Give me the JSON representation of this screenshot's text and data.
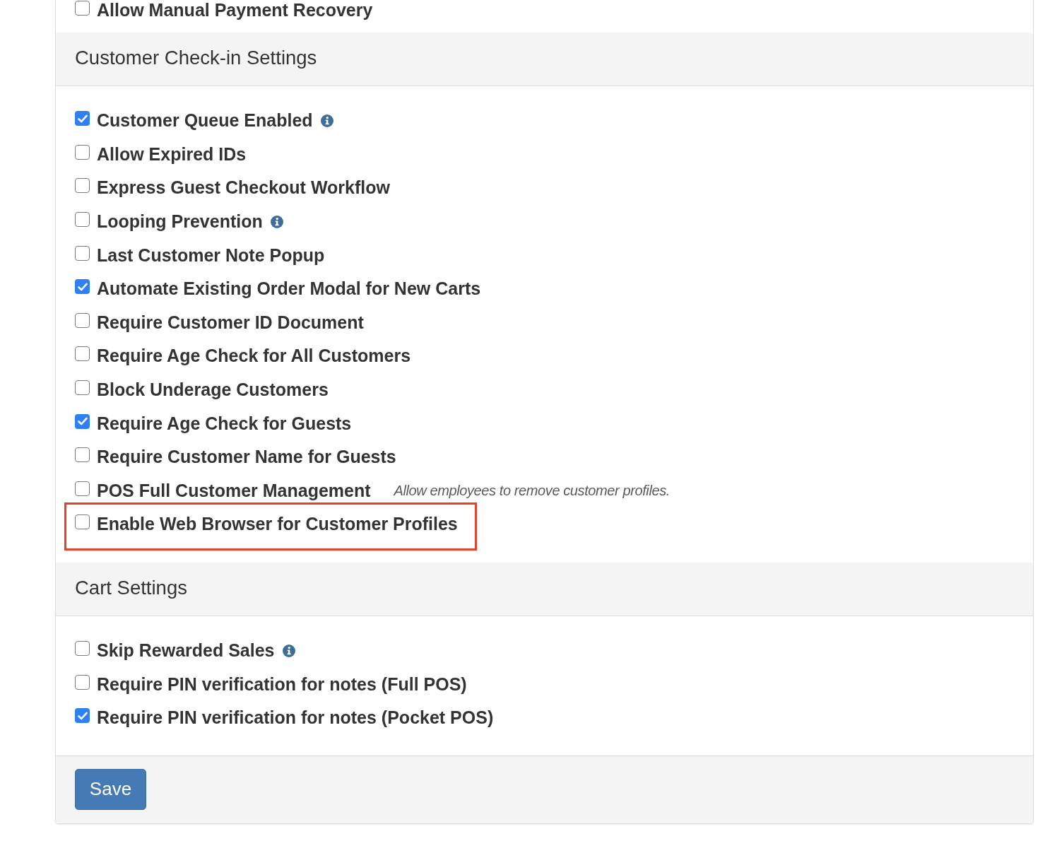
{
  "sections": [
    {
      "options": [
        {
          "label": "Allow Manual Payment Recovery",
          "checked": false,
          "info": false,
          "highlighted": false
        }
      ]
    },
    {
      "title": "Customer Check-in Settings",
      "options": [
        {
          "label": "Customer Queue Enabled",
          "checked": true,
          "info": true,
          "highlighted": false
        },
        {
          "label": "Allow Expired IDs",
          "checked": false,
          "info": false,
          "highlighted": false
        },
        {
          "label": "Express Guest Checkout Workflow",
          "checked": false,
          "info": false,
          "highlighted": false
        },
        {
          "label": "Looping Prevention",
          "checked": false,
          "info": true,
          "highlighted": false
        },
        {
          "label": "Last Customer Note Popup",
          "checked": false,
          "info": false,
          "highlighted": false
        },
        {
          "label": "Automate Existing Order Modal for New Carts",
          "checked": true,
          "info": false,
          "highlighted": false
        },
        {
          "label": "Require Customer ID Document",
          "checked": false,
          "info": false,
          "highlighted": false
        },
        {
          "label": "Require Age Check for All Customers",
          "checked": false,
          "info": false,
          "highlighted": false
        },
        {
          "label": "Block Underage Customers",
          "checked": false,
          "info": false,
          "highlighted": false
        },
        {
          "label": "Require Age Check for Guests",
          "checked": true,
          "info": false,
          "highlighted": false
        },
        {
          "label": "Require Customer Name for Guests",
          "checked": false,
          "info": false,
          "highlighted": false
        },
        {
          "label": "POS Full Customer Management",
          "checked": false,
          "info": false,
          "highlighted": false,
          "hint": "Allow employees to remove customer profiles."
        },
        {
          "label": "Enable Web Browser for Customer Profiles",
          "checked": false,
          "info": false,
          "highlighted": true
        }
      ]
    },
    {
      "title": "Cart Settings",
      "options": [
        {
          "label": "Skip Rewarded Sales",
          "checked": false,
          "info": true,
          "highlighted": false
        },
        {
          "label": "Require PIN verification for notes (Full POS)",
          "checked": false,
          "info": false,
          "highlighted": false
        },
        {
          "label": "Require PIN verification for notes (Pocket POS)",
          "checked": true,
          "info": false,
          "highlighted": false
        }
      ]
    }
  ],
  "save_button": "Save"
}
